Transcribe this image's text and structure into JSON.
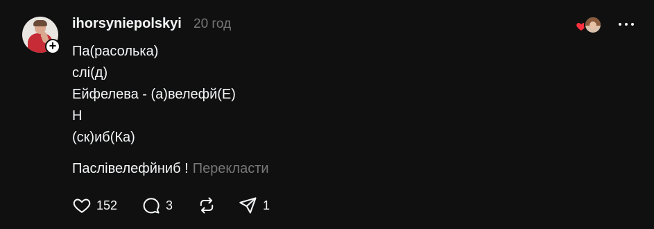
{
  "post": {
    "username": "ihorsyniepolskyi",
    "time": "20 год",
    "lines": [
      "Па(расолька)",
      "слі(д)",
      "Ейфелева - (а)велефй(Е)",
      "Н",
      "(ск)иб(Ка)"
    ],
    "final_text": "Паслівелефйниб !",
    "translate_label": "Перекласти"
  },
  "actions": {
    "likes": "152",
    "comments": "3",
    "shares": "1"
  },
  "icons": {
    "follow": "plus-icon",
    "like": "heart-icon",
    "comment": "comment-icon",
    "repost": "repost-icon",
    "share": "send-icon",
    "more": "more-icon",
    "liked_heart": "heart-icon"
  },
  "colors": {
    "background": "#101010",
    "text": "#f3f5f7",
    "muted": "#777777",
    "like_red": "#ff3040"
  }
}
